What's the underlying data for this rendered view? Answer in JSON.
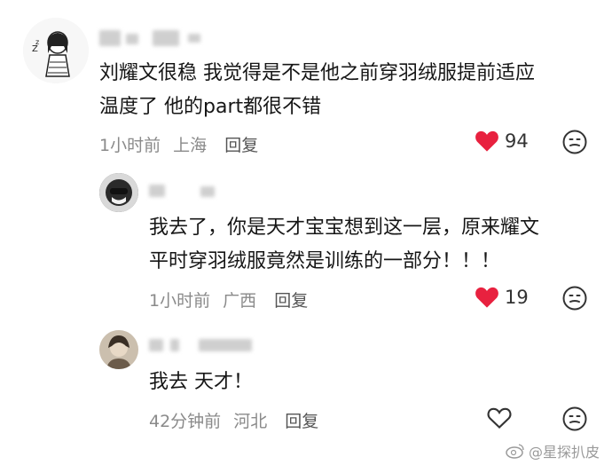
{
  "comments": [
    {
      "text_line1": "刘耀文很稳 我觉得是不是他之前穿羽绒服提前适应",
      "text_line2": "温度了  他的part都很不错",
      "time": "1小时前",
      "location": "上海",
      "reply_label": "回复",
      "likes": "94",
      "liked": true
    },
    {
      "text_line1": "我去了，你是天才宝宝想到这一层，原来耀文",
      "text_line2": "平时穿羽绒服竟然是训练的一部分！！！",
      "time": "1小时前",
      "location": "广西",
      "reply_label": "回复",
      "likes": "19",
      "liked": true
    },
    {
      "text_line1": "我去 天才！",
      "time": "42分钟前",
      "location": "河北",
      "reply_label": "回复",
      "likes": "",
      "liked": false
    }
  ],
  "watermark": "@星探扒皮",
  "colors": {
    "like_red": "#e8213f",
    "meta_gray": "#8a8a8a",
    "icon_gray": "#333333"
  }
}
